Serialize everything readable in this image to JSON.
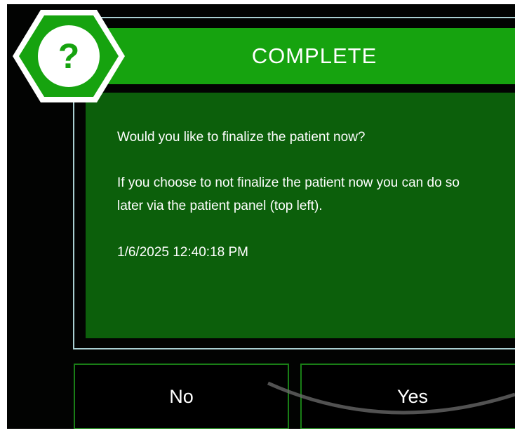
{
  "dialog": {
    "title": "COMPLETE",
    "question": "Would you like to finalize the patient now?",
    "explanation": "If you choose to not finalize the patient now you can do so later via the patient panel (top left).",
    "timestamp": "1/6/2025 12:40:18 PM",
    "icon_glyph": "?",
    "icon": "question-hexagon-icon"
  },
  "buttons": {
    "no_label": "No",
    "yes_label": "Yes"
  },
  "colors": {
    "background": "#020302",
    "title_bar": "#16a30f",
    "message_panel": "#0c5f0b",
    "frame_border": "#a9cfd2",
    "button_border": "#197e16",
    "text": "#ffffff"
  }
}
